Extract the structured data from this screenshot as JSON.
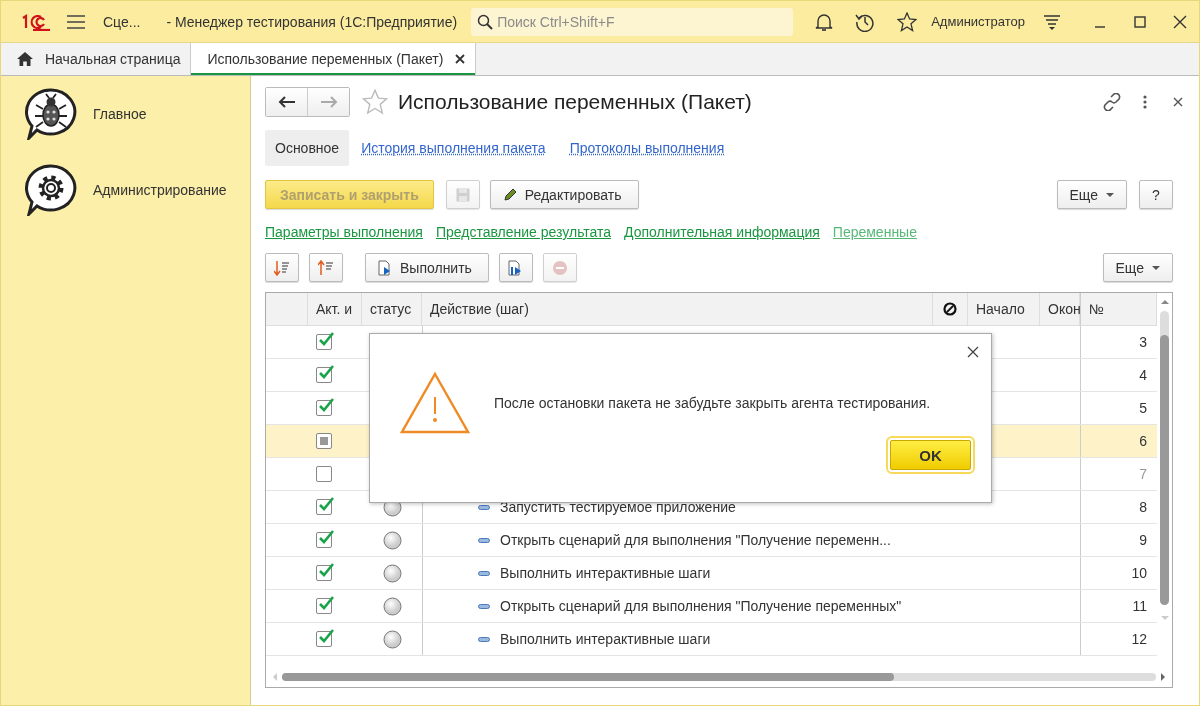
{
  "window": {
    "title_prefix": "Сце...",
    "title": "- Менеджер тестирования (1С:Предприятие)",
    "search": {
      "placeholder": "Поиск Ctrl+Shift+F"
    },
    "user": "Администратор"
  },
  "tabs": [
    {
      "label": "Начальная страница",
      "selected": false,
      "kind": "home"
    },
    {
      "label": "Использование переменных (Пакет)",
      "selected": true,
      "kind": "form"
    }
  ],
  "sidebar": {
    "items": [
      {
        "label": "Главное",
        "kind": "bug"
      },
      {
        "label": "Администрирование",
        "kind": "gear"
      }
    ]
  },
  "form": {
    "title": "Использование переменных (Пакет)",
    "nav": [
      {
        "label": "Основное",
        "selected": true
      },
      {
        "label": "История выполнения пакета",
        "selected": false
      },
      {
        "label": "Протоколы выполнения",
        "selected": false
      }
    ],
    "toolbar": {
      "save_close": "Записать и закрыть",
      "edit": "Редактировать",
      "more": "Еще",
      "help": "?"
    },
    "links": [
      {
        "label": "Параметры выполнения",
        "selected": false
      },
      {
        "label": "Представление результата",
        "selected": false
      },
      {
        "label": "Дополнительная информация",
        "selected": false
      },
      {
        "label": "Переменные",
        "selected": true
      }
    ],
    "table_toolbar": {
      "run": "Выполнить",
      "more": "Еще"
    }
  },
  "table": {
    "columns": [
      {
        "kind": "blank"
      },
      {
        "kind": "text",
        "label": "Акт. и"
      },
      {
        "kind": "text",
        "label": "статус"
      },
      {
        "kind": "text",
        "label": "Действие (шаг)"
      },
      {
        "kind": "icon"
      },
      {
        "kind": "text",
        "label": "Начало"
      },
      {
        "kind": "text",
        "label": "Окон"
      },
      {
        "kind": "text",
        "label": "№"
      }
    ],
    "rows": [
      {
        "number": "3",
        "checked": true,
        "indeterminate": false,
        "selected": false,
        "disabled": false
      },
      {
        "number": "4",
        "checked": true,
        "indeterminate": false,
        "selected": false,
        "disabled": false
      },
      {
        "number": "5",
        "checked": true,
        "indeterminate": false,
        "selected": false,
        "disabled": false
      },
      {
        "number": "6",
        "checked": false,
        "indeterminate": true,
        "selected": true,
        "disabled": false
      },
      {
        "number": "7",
        "checked": false,
        "indeterminate": false,
        "selected": false,
        "disabled": true
      },
      {
        "number": "8",
        "checked": true,
        "indeterminate": false,
        "selected": false,
        "disabled": false,
        "action": "Запустить тестируемое приложение"
      },
      {
        "number": "9",
        "checked": true,
        "indeterminate": false,
        "selected": false,
        "disabled": false,
        "action": "Открыть сценарий для выполнения \"Получение переменн..."
      },
      {
        "number": "10",
        "checked": true,
        "indeterminate": false,
        "selected": false,
        "disabled": false,
        "action": "Выполнить интерактивные шаги"
      },
      {
        "number": "11",
        "checked": true,
        "indeterminate": false,
        "selected": false,
        "disabled": false,
        "action": "Открыть сценарий для выполнения \"Получение переменных\""
      },
      {
        "number": "12",
        "checked": true,
        "indeterminate": false,
        "selected": false,
        "disabled": false,
        "action": "Выполнить интерактивные шаги"
      }
    ]
  },
  "dialog": {
    "message": "После остановки пакета не забудьте закрыть агента тестирования.",
    "ok": "OK"
  }
}
